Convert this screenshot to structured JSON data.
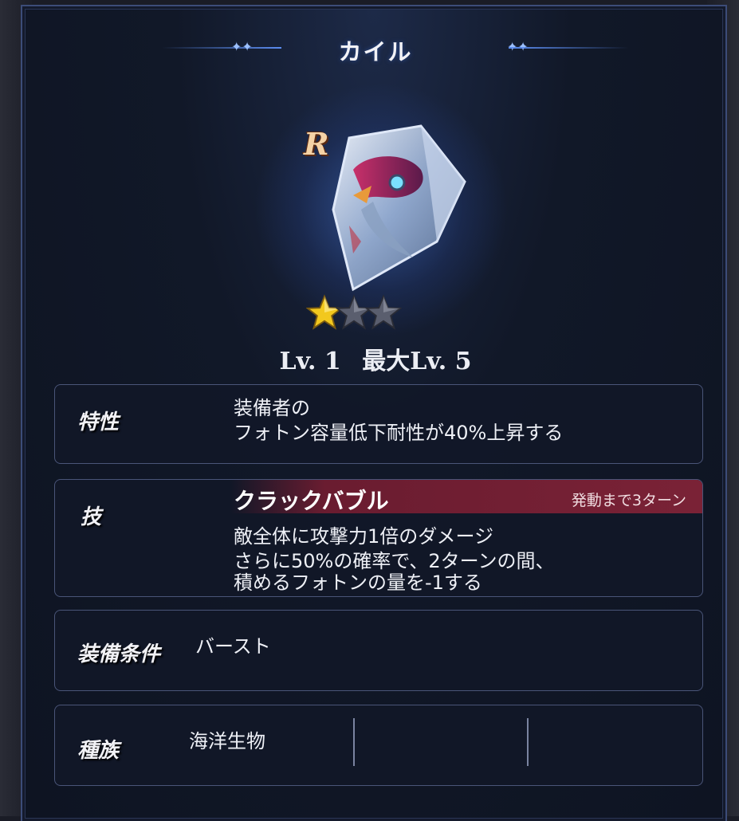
{
  "title": "カイル",
  "rarity": "R",
  "stars": {
    "filled": 1,
    "total": 3
  },
  "level": {
    "current": "Lv. 1",
    "max": "最大Lv. 5"
  },
  "trait": {
    "label": "特性",
    "line1": "装備者の",
    "line2": "フォトン容量低下耐性が40%上昇する"
  },
  "skill": {
    "label": "技",
    "name": "クラックバブル",
    "turns": "発動まで3ターン",
    "line1": "敵全体に攻撃力1倍のダメージ",
    "line2": "さらに50%の確率で、2ターンの間、",
    "line3": "積めるフォトンの量を-1する"
  },
  "equip": {
    "label": "装備条件",
    "value": "バースト"
  },
  "race": {
    "label": "種族",
    "value": "海洋生物"
  },
  "colors": {
    "panel_border": "#3c4c78",
    "skill_bar": "#7a2236",
    "star_gold": "#f2c81e"
  }
}
